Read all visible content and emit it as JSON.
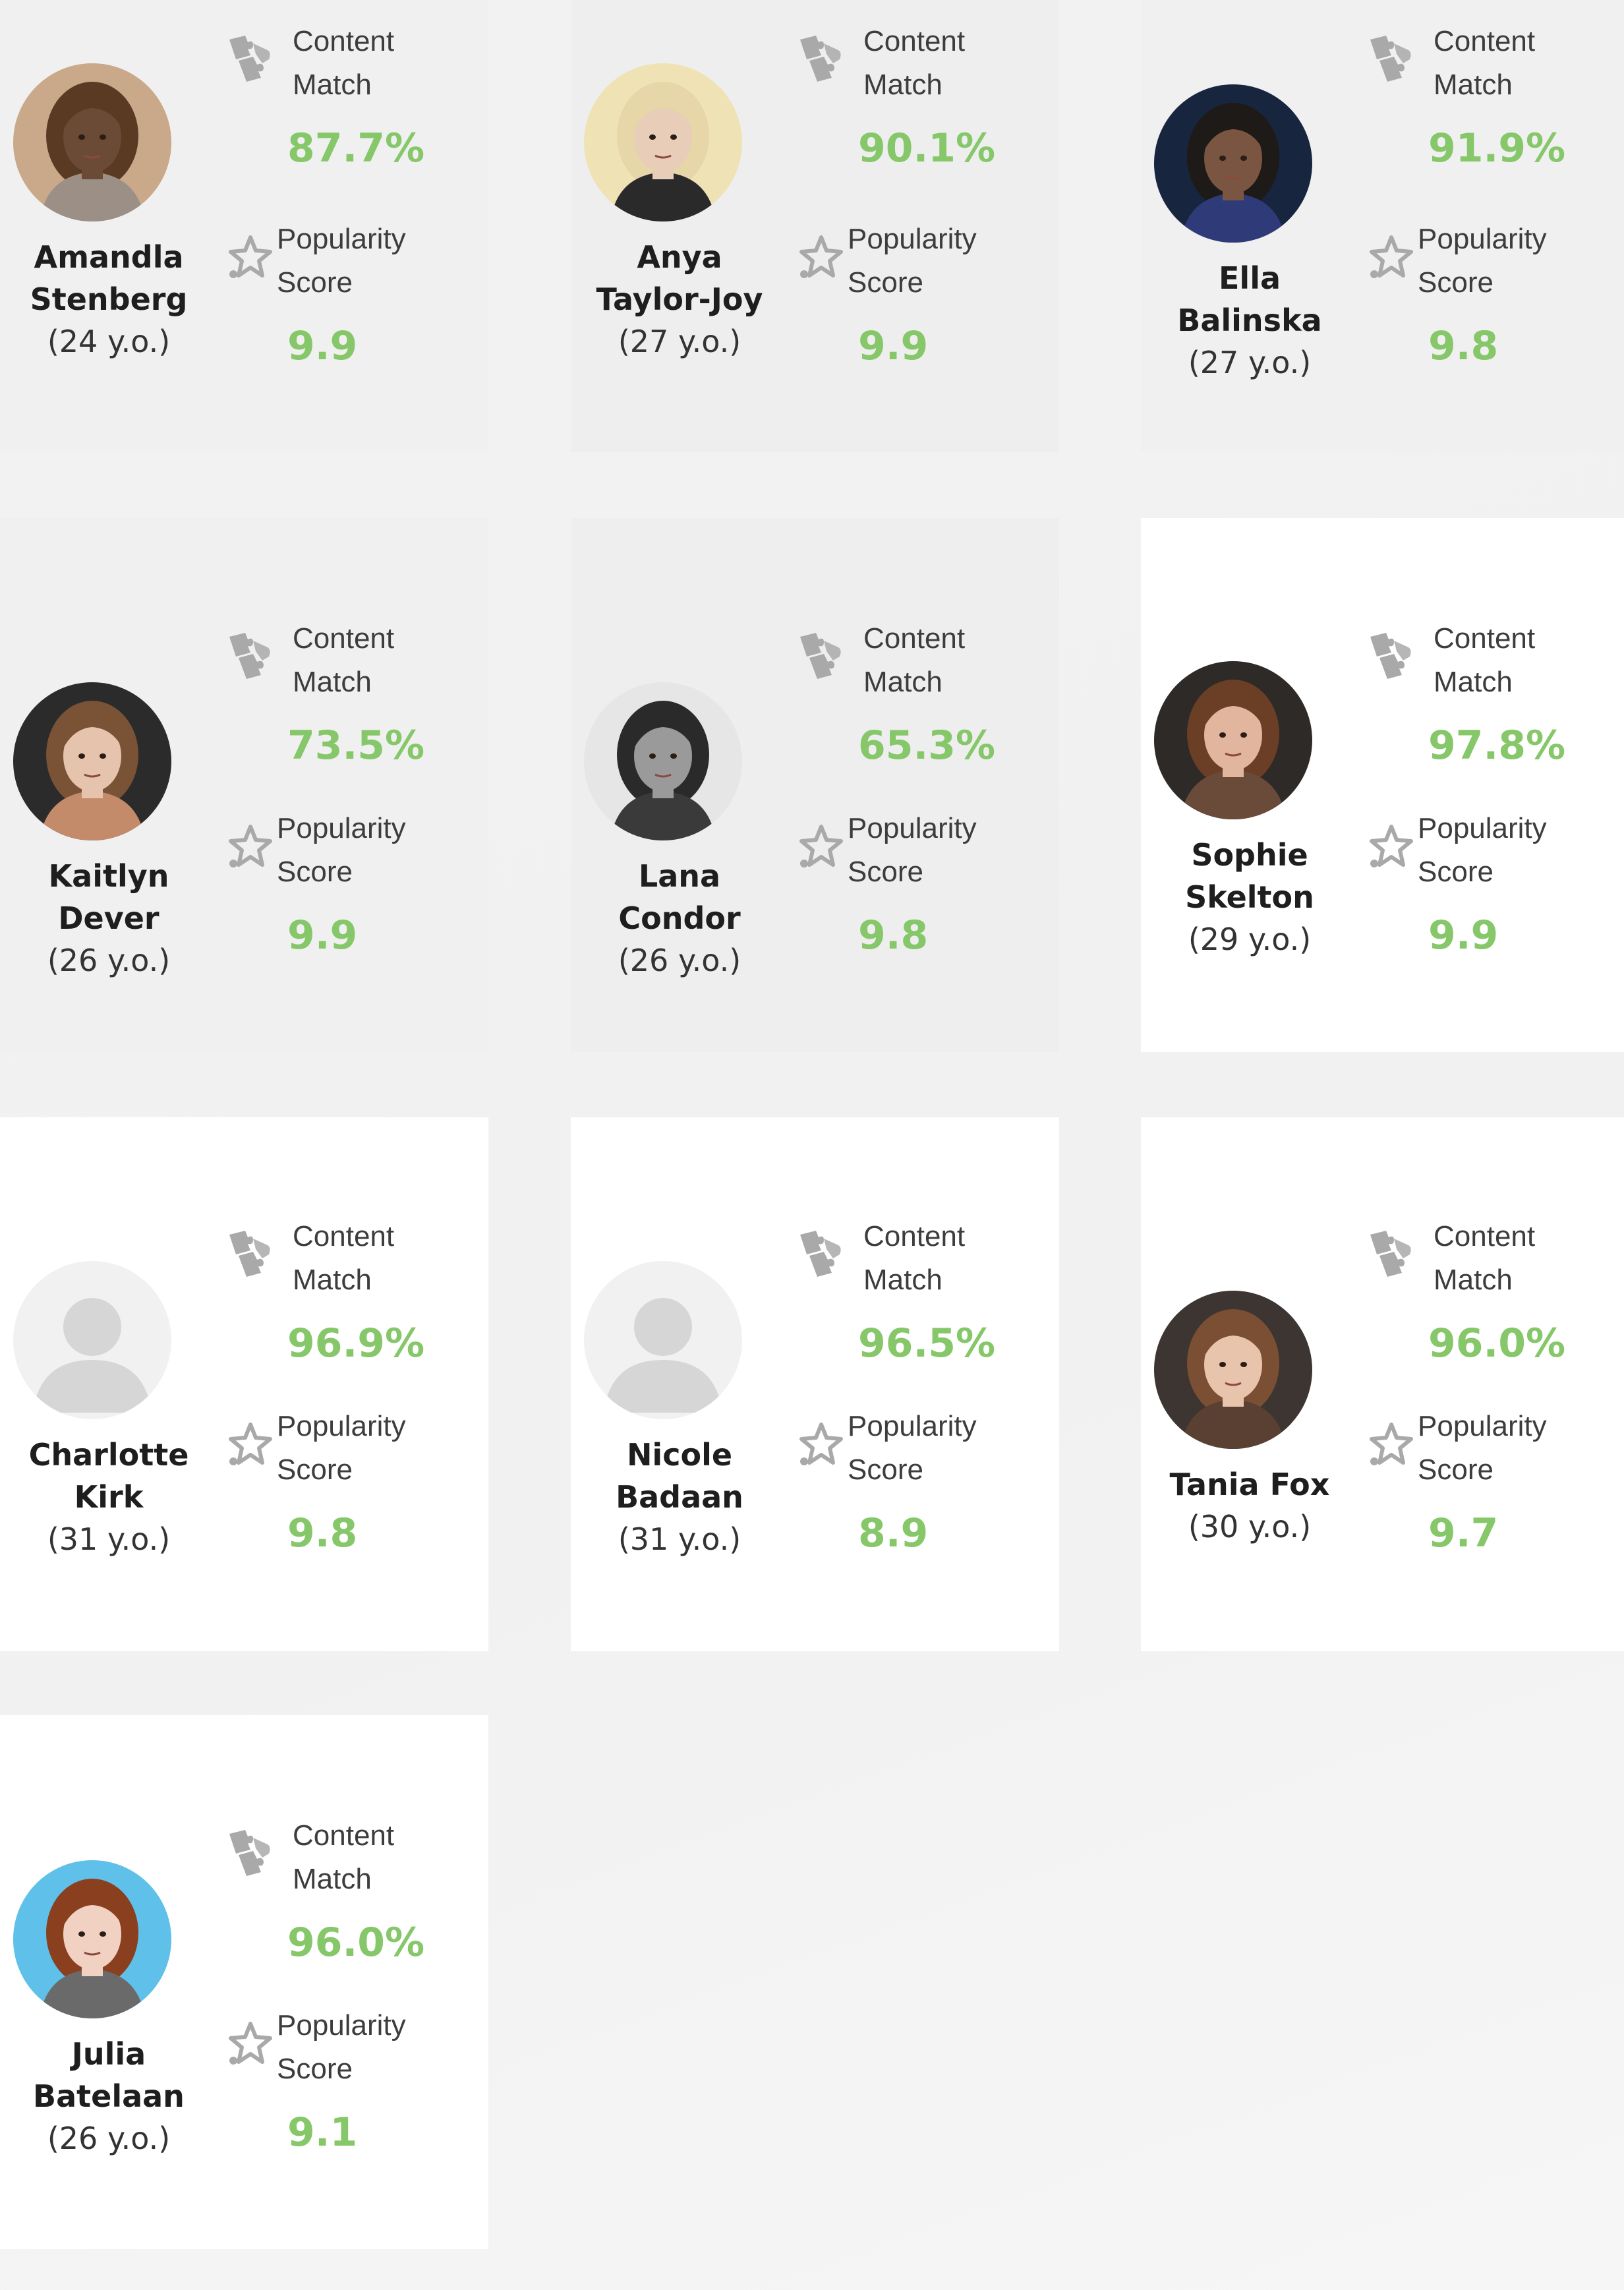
{
  "labels": {
    "content_line1": "Content",
    "content_line2": "Match",
    "popularity_line1": "Popularity",
    "popularity_line2": "Score"
  },
  "colors": {
    "value_green": "#86c76a",
    "icon_grey": "#a9a9a9"
  },
  "icons": {
    "content_match": "puzzle-hand-icon",
    "popularity": "star-outline-icon",
    "placeholder_avatar": "person-silhouette-icon"
  },
  "cards": [
    {
      "name": "Amandla Stenberg",
      "age": "(24 y.o.)",
      "content_match": "87.7%",
      "popularity": "9.9"
    },
    {
      "name": "Anya Taylor-Joy",
      "age": "(27 y.o.)",
      "content_match": "90.1%",
      "popularity": "9.9"
    },
    {
      "name": "Ella Balinska",
      "age": "(27 y.o.)",
      "content_match": "91.9%",
      "popularity": "9.8"
    },
    {
      "name": "Kaitlyn Dever",
      "age": "(26 y.o.)",
      "content_match": "73.5%",
      "popularity": "9.9"
    },
    {
      "name": "Lana Condor",
      "age": "(26 y.o.)",
      "content_match": "65.3%",
      "popularity": "9.8"
    },
    {
      "name": "Sophie Skelton",
      "age": "(29 y.o.)",
      "content_match": "97.8%",
      "popularity": "9.9"
    },
    {
      "name": "Charlotte Kirk",
      "age": "(31 y.o.)",
      "content_match": "96.9%",
      "popularity": "9.8"
    },
    {
      "name": "Nicole Badaan",
      "age": "(31 y.o.)",
      "content_match": "96.5%",
      "popularity": "8.9"
    },
    {
      "name": "Tania Fox",
      "age": "(30 y.o.)",
      "content_match": "96.0%",
      "popularity": "9.7"
    },
    {
      "name": "Julia Batelaan",
      "age": "(26 y.o.)",
      "content_match": "96.0%",
      "popularity": "9.1"
    }
  ]
}
